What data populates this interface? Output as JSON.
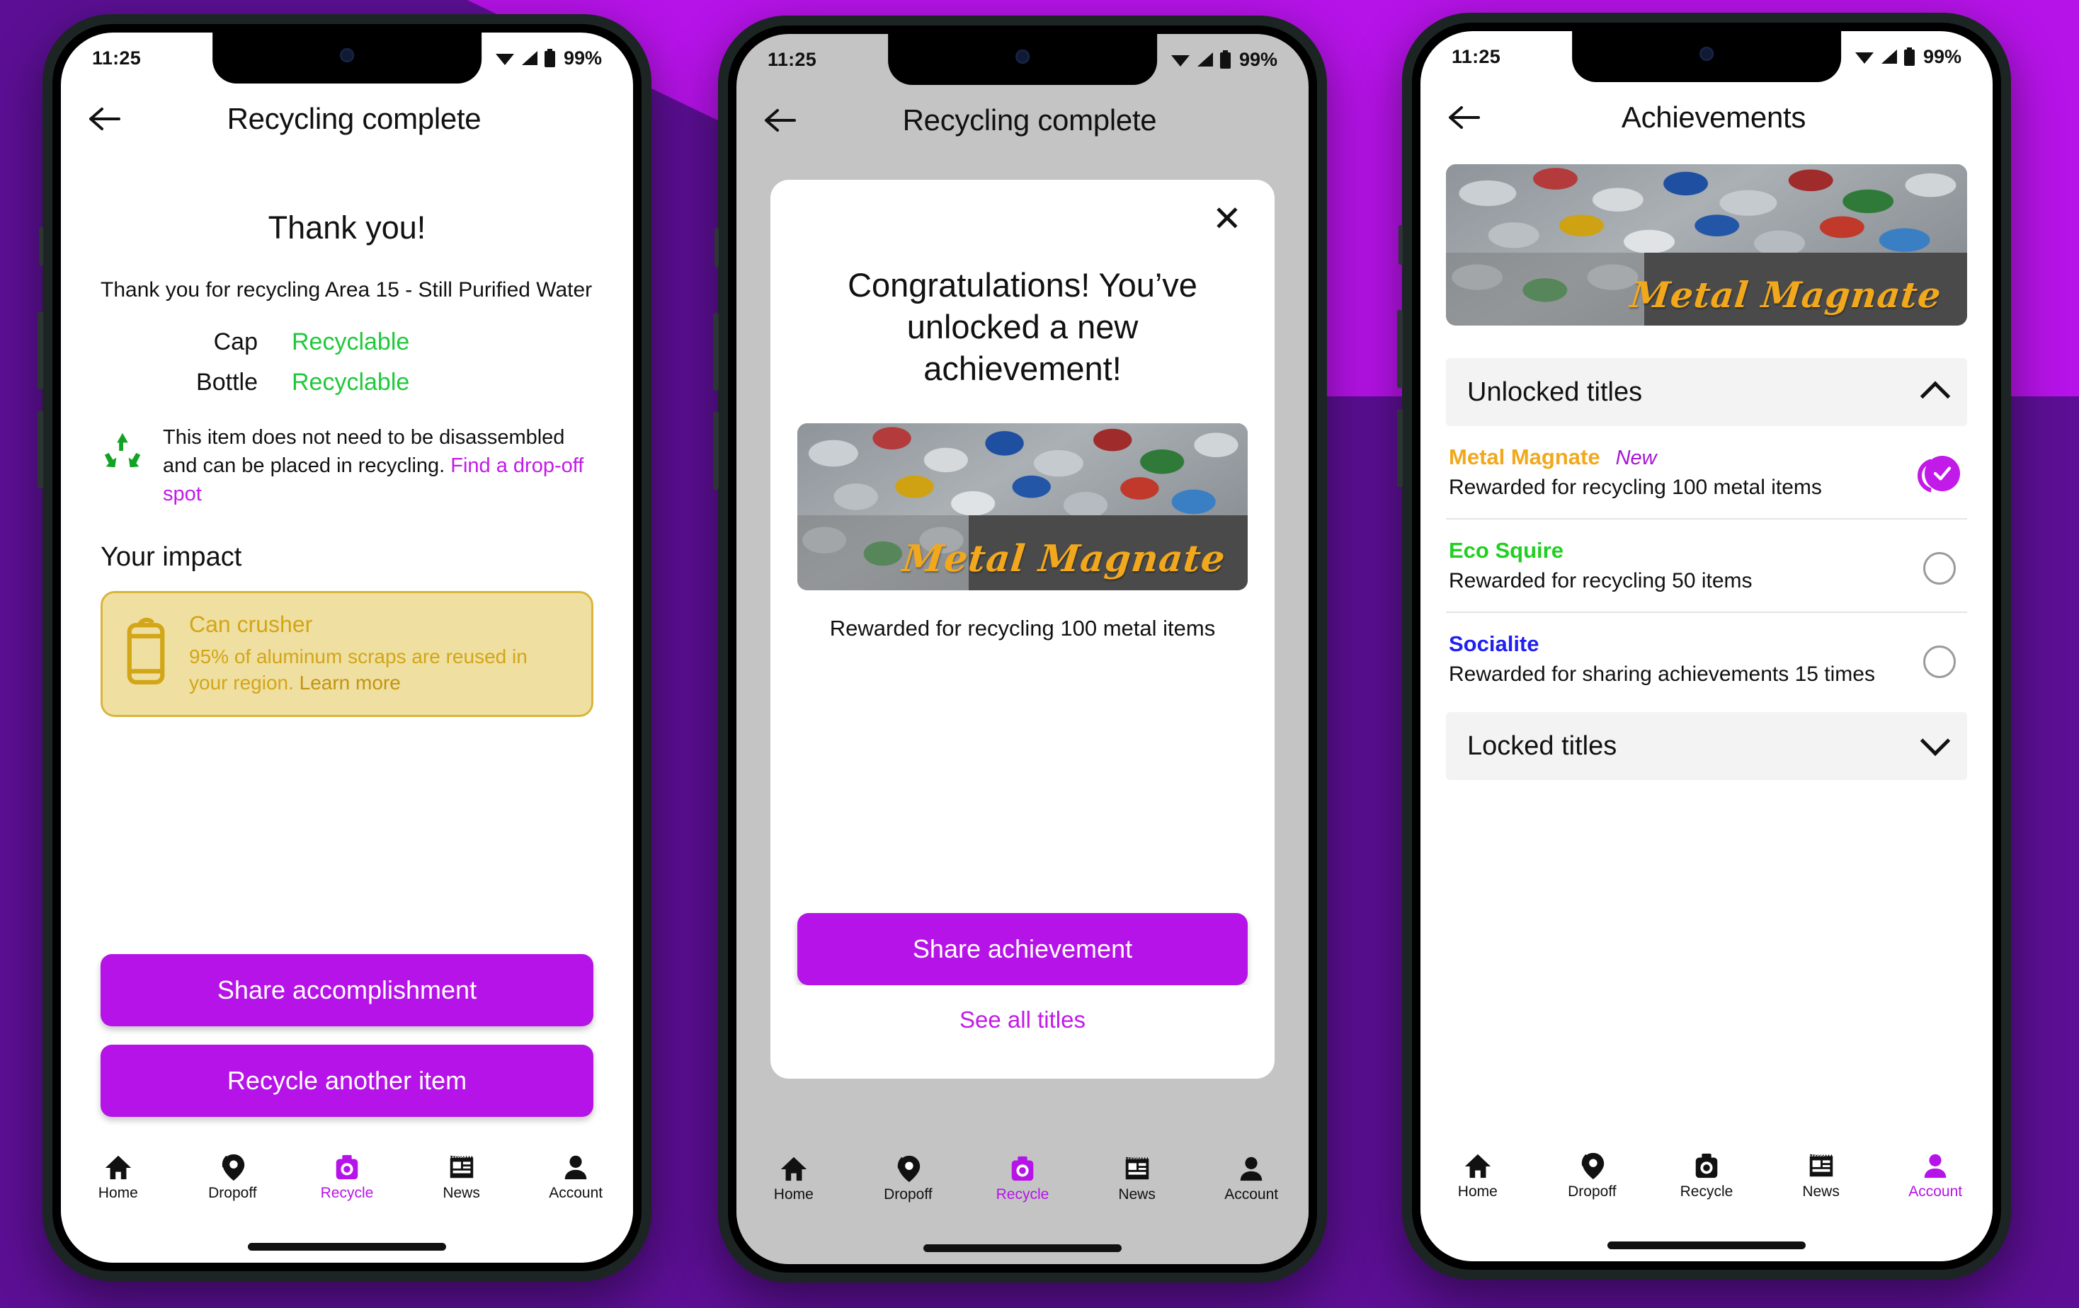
{
  "theme": {
    "background_purple": "#B613E8",
    "background_purple_dark": "#5C0F94",
    "accent": "#B613E8",
    "link": "#C21AE8",
    "recyclable_green": "#1FC93A",
    "gold": "#D2A617",
    "gold_card_bg": "#EFDFA1"
  },
  "statusbar": {
    "time": "11:25",
    "battery": "99%",
    "wifi_icon": "wifi-icon",
    "signal_icon": "signal-icon",
    "battery_icon": "battery-icon"
  },
  "nav": {
    "items": [
      {
        "label": "Home",
        "icon": "home-icon"
      },
      {
        "label": "Dropoff",
        "icon": "map-pin-icon"
      },
      {
        "label": "Recycle",
        "icon": "camera-icon"
      },
      {
        "label": "News",
        "icon": "newspaper-icon"
      },
      {
        "label": "Account",
        "icon": "person-icon"
      }
    ],
    "active_phone1": "Recycle",
    "active_phone2": "Recycle",
    "active_phone3": "Account"
  },
  "phone1": {
    "appbar": {
      "title": "Recycling complete",
      "back_icon": "back-arrow-icon",
      "menu_icon": "hamburger-menu-icon"
    },
    "heading": "Thank you!",
    "subtitle": "Thank you for recycling Area 15 - Still Purified Water",
    "parts": [
      {
        "name": "Cap",
        "status": "Recyclable"
      },
      {
        "name": "Bottle",
        "status": "Recyclable"
      }
    ],
    "note": {
      "icon": "recycle-icon",
      "text": "This item does not need to be disassembled and can be placed in recycling. ",
      "link": "Find a drop-off spot"
    },
    "impact_heading": "Your impact",
    "impact_card": {
      "icon": "can-icon",
      "title": "Can crusher",
      "body": "95% of aluminum scraps are reused in your region. ",
      "link": "Learn more"
    },
    "buttons": {
      "share": "Share accomplishment",
      "recycle_another": "Recycle another item"
    }
  },
  "phone2": {
    "appbar": {
      "title": "Recycling complete",
      "back_icon": "back-arrow-icon",
      "menu_icon": "hamburger-menu-icon"
    },
    "modal": {
      "close_icon": "close-icon",
      "title": "Congratulations! You’ve unlocked a new achievement!",
      "badge_name": "Metal Magnate",
      "badge_image": "crushed-aluminum-cans-photo",
      "caption": "Rewarded for recycling 100 metal items",
      "primary_button": "Share achievement",
      "secondary_button": "See all titles"
    }
  },
  "phone3": {
    "appbar": {
      "title": "Achievements",
      "back_icon": "back-arrow-icon",
      "menu_icon": "hamburger-menu-icon"
    },
    "hero_badge": {
      "name": "Metal Magnate",
      "image": "crushed-aluminum-cans-photo"
    },
    "sections": [
      {
        "label": "Unlocked titles",
        "expanded": true,
        "chevron": "chevron-up-icon"
      },
      {
        "label": "Locked titles",
        "expanded": false,
        "chevron": "chevron-down-icon"
      }
    ],
    "achievements": [
      {
        "title": "Metal Magnate",
        "title_color": "#F2A81C",
        "badge": "New",
        "description": "Rewarded for recycling 100 metal items",
        "state": "checked"
      },
      {
        "title": "Eco Squire",
        "title_color": "#20D020",
        "badge": "",
        "description": "Rewarded for recycling 50 items",
        "state": "unchecked"
      },
      {
        "title": "Socialite",
        "title_color": "#2020F0",
        "badge": "",
        "description": "Rewarded for sharing achievements 15 times",
        "state": "unchecked"
      }
    ]
  }
}
